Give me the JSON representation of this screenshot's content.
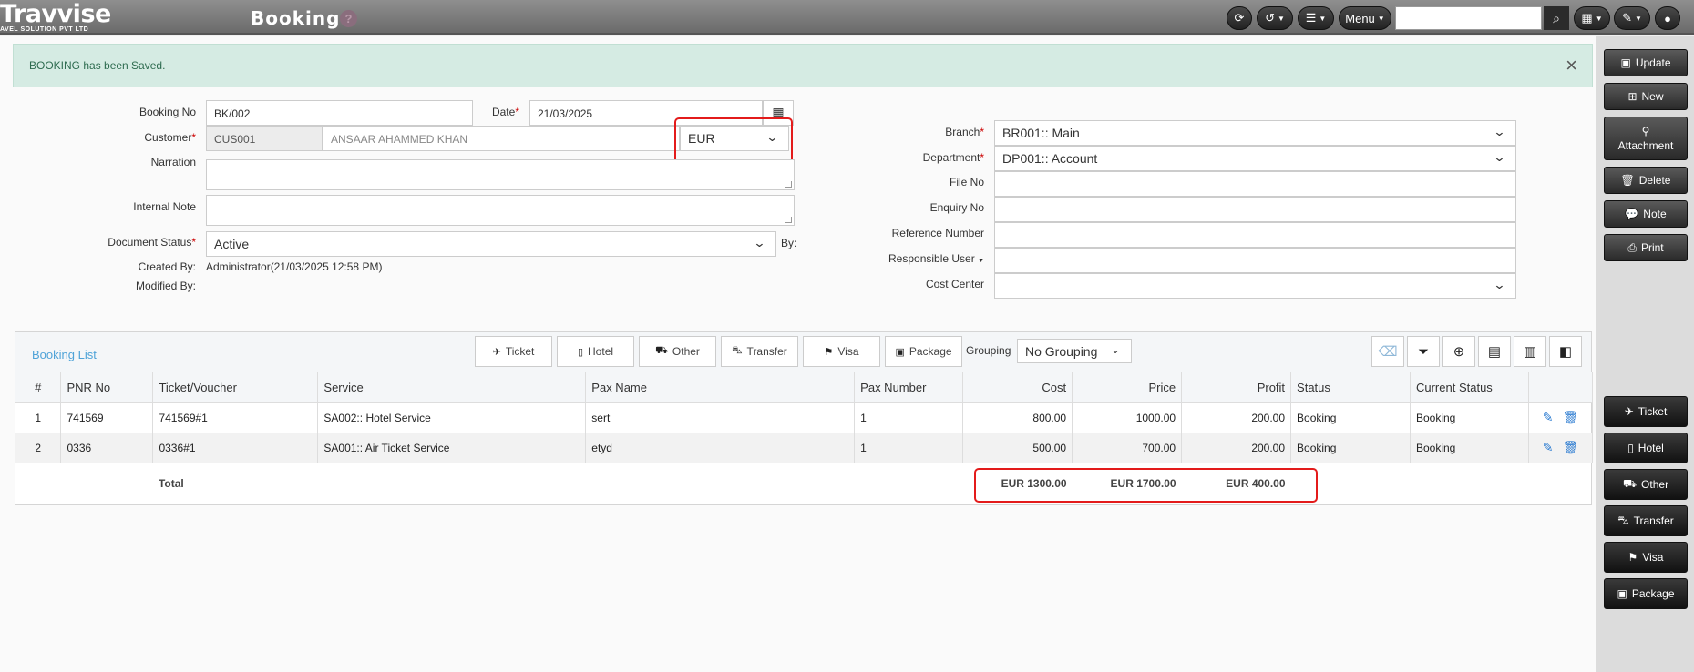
{
  "topbar": {
    "logo_name": "Travvise",
    "logo_tag": "AVEL SOLUTION PVT LTD",
    "title": "Booking",
    "help": "?",
    "menu_label": "Menu",
    "search_placeholder": ""
  },
  "alert": {
    "message": "BOOKING has been Saved.",
    "close": "×"
  },
  "form": {
    "booking_no_label": "Booking No",
    "booking_no": "BK/002",
    "date_label": "Date",
    "date": "21/03/2025",
    "customer_label": "Customer",
    "customer_code": "CUS001",
    "customer_name": "ANSAAR AHAMMED KHAN",
    "currency": "EUR",
    "narration_label": "Narration",
    "internal_note_label": "Internal Note",
    "doc_status_label": "Document Status",
    "doc_status": "Active",
    "by_label": "By:",
    "created_by_label": "Created By:",
    "created_by": "Administrator(21/03/2025 12:58 PM)",
    "modified_by_label": "Modified By:",
    "branch_label": "Branch",
    "branch": "BR001:: Main",
    "department_label": "Department",
    "department": "DP001:: Account",
    "file_no_label": "File No",
    "enquiry_no_label": "Enquiry No",
    "reference_label": "Reference Number",
    "responsible_label": "Responsible User",
    "cost_center_label": "Cost Center",
    "required_mark": "*"
  },
  "booking_list": {
    "title": "Booking List",
    "buttons": [
      "Ticket",
      "Hotel",
      "Other",
      "Transfer",
      "Visa",
      "Package"
    ],
    "grouping_label": "Grouping",
    "grouping_value": "No Grouping",
    "columns": [
      "#",
      "PNR No",
      "Ticket/Voucher",
      "Service",
      "Pax Name",
      "Pax Number",
      "Cost",
      "Price",
      "Profit",
      "Status",
      "Current Status"
    ],
    "rows": [
      {
        "idx": "1",
        "pnr": "741569",
        "voucher": "741569#1",
        "service": "SA002:: Hotel Service",
        "pax": "sert",
        "pax_no": "1",
        "cost": "800.00",
        "price": "1000.00",
        "profit": "200.00",
        "status": "Booking",
        "current": "Booking"
      },
      {
        "idx": "2",
        "pnr": "0336",
        "voucher": "0336#1",
        "service": "SA001:: Air Ticket Service",
        "pax": "etyd",
        "pax_no": "1",
        "cost": "500.00",
        "price": "700.00",
        "profit": "200.00",
        "status": "Booking",
        "current": "Booking"
      }
    ],
    "total_label": "Total",
    "total_cost": "EUR 1300.00",
    "total_price": "EUR 1700.00",
    "total_profit": "EUR 400.00"
  },
  "sidebar": {
    "top": [
      "Update",
      "New",
      "Attachment",
      "Delete",
      "Note",
      "Print"
    ],
    "bottom": [
      "Ticket",
      "Hotel",
      "Other",
      "Transfer",
      "Visa",
      "Package"
    ]
  }
}
